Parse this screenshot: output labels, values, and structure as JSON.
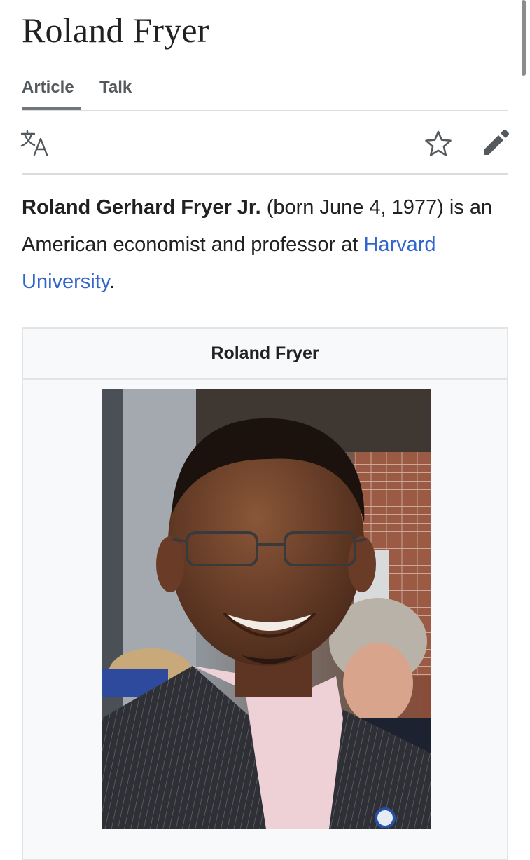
{
  "page": {
    "title": "Roland Fryer"
  },
  "tabs": [
    {
      "label": "Article",
      "active": true
    },
    {
      "label": "Talk",
      "active": false
    }
  ],
  "toolbar": {
    "icons": [
      "language-icon",
      "star-icon",
      "edit-pencil-icon"
    ]
  },
  "lead": {
    "name": "Roland Gerhard Fryer Jr.",
    "text_before_link": " (born June 4, 1977) is an American economist and professor at ",
    "link_text": "Harvard University",
    "text_after_link": "."
  },
  "infobox": {
    "title": "Roland Fryer",
    "image": "portrait-photo"
  },
  "colors": {
    "link": "#3366cc",
    "text": "#202122",
    "tab_text": "#54595d",
    "infobox_bg": "#f8f9fa",
    "divider": "#dcdcdc"
  }
}
